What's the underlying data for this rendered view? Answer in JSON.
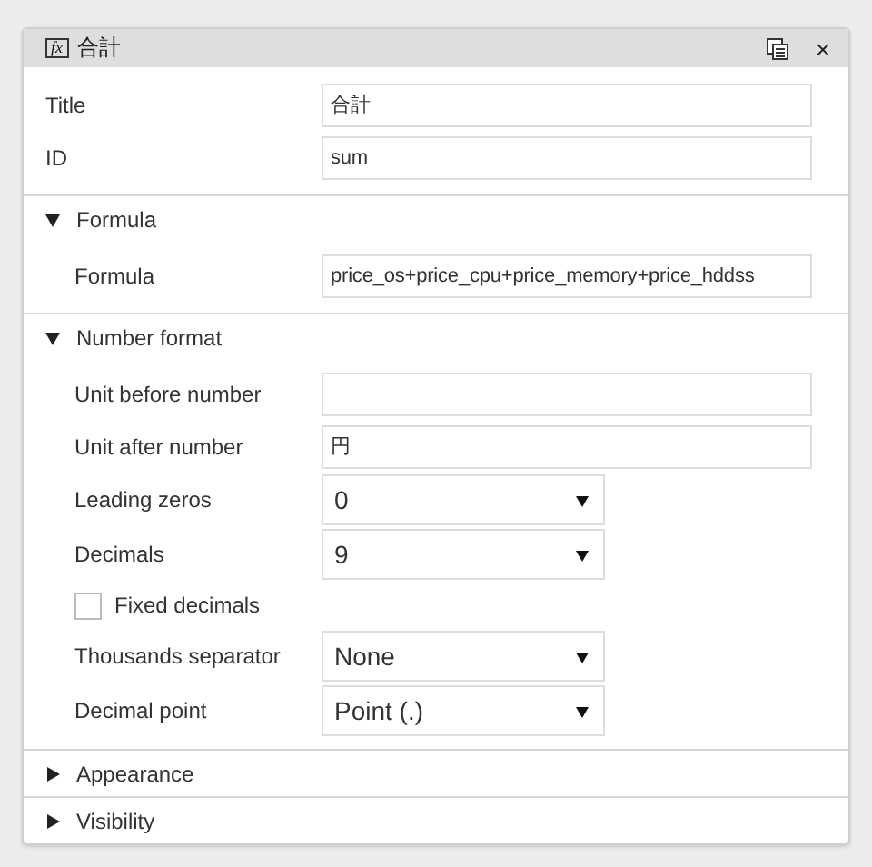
{
  "header": {
    "icon": "fx",
    "title": "合計",
    "close": "×"
  },
  "fields": [
    {
      "kind": "text",
      "label": "Title",
      "value": "合計"
    },
    {
      "kind": "text",
      "label": "ID",
      "value": "sum"
    }
  ],
  "sections": [
    {
      "title": "Formula",
      "expanded": true,
      "rows": [
        {
          "kind": "text",
          "label": "Formula",
          "value": "price_os+price_cpu+price_memory+price_hddss"
        }
      ]
    },
    {
      "title": "Number format",
      "expanded": true,
      "rows": [
        {
          "kind": "text",
          "label": "Unit before number",
          "value": ""
        },
        {
          "kind": "text",
          "label": "Unit after number",
          "value": "円"
        },
        {
          "kind": "select",
          "label": "Leading zeros",
          "value": "0"
        },
        {
          "kind": "select",
          "label": "Decimals",
          "value": "9"
        },
        {
          "kind": "checkbox",
          "label": "Fixed decimals",
          "checked": false
        },
        {
          "kind": "select",
          "label": "Thousands separator",
          "value": "None"
        },
        {
          "kind": "select",
          "label": "Decimal point",
          "value": "Point (.)"
        }
      ]
    },
    {
      "title": "Appearance",
      "expanded": false
    },
    {
      "title": "Visibility",
      "expanded": false
    }
  ]
}
